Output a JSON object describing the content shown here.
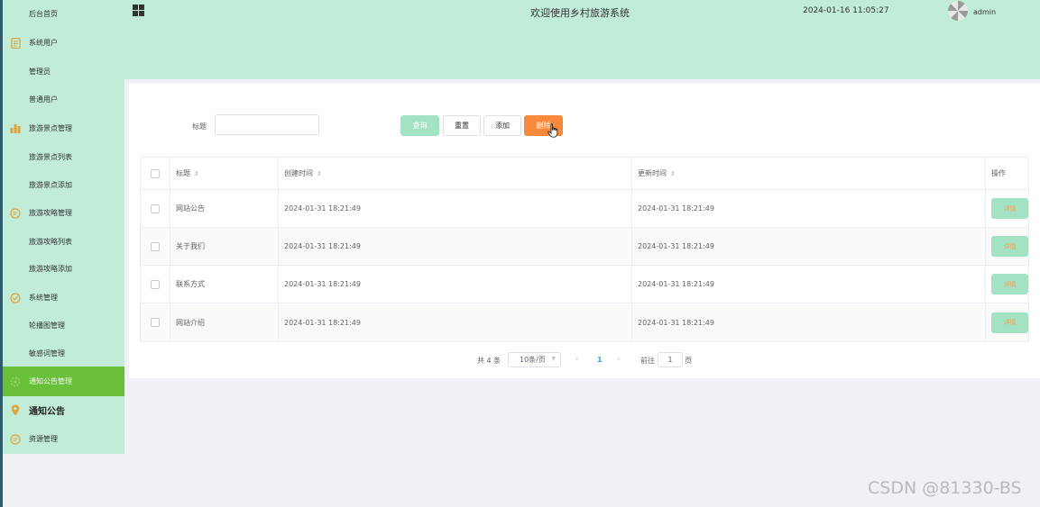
{
  "colors": {
    "sidebar_bg": "#c0ecd8",
    "active_bg": "#6ac03b",
    "primary_light": "#a3e3c4",
    "danger": "#f6893b",
    "link": "#35a0e6"
  },
  "sidebar": {
    "items": [
      {
        "label": "后台首页",
        "icon": ""
      },
      {
        "label": "系统用户",
        "icon": "document-icon"
      },
      {
        "label": "管理员",
        "icon": ""
      },
      {
        "label": "普通用户",
        "icon": ""
      },
      {
        "label": "旅游景点管理",
        "icon": "bar-chart-icon"
      },
      {
        "label": "旅游景点列表",
        "icon": ""
      },
      {
        "label": "旅游景点添加",
        "icon": ""
      },
      {
        "label": "旅游攻略管理",
        "icon": "chat-icon"
      },
      {
        "label": "旅游攻略列表",
        "icon": ""
      },
      {
        "label": "旅游攻略添加",
        "icon": ""
      },
      {
        "label": "系统管理",
        "icon": "check-circle-icon"
      },
      {
        "label": "轮播图管理",
        "icon": ""
      },
      {
        "label": "敏感词管理",
        "icon": ""
      },
      {
        "label": "通知公告管理",
        "icon": "gear-icon"
      },
      {
        "label": "通知公告",
        "icon": "location-icon"
      },
      {
        "label": "资源管理",
        "icon": "chat-icon"
      }
    ]
  },
  "header": {
    "title": "欢迎使用乡村旅游系统",
    "datetime": "2024-01-16 11:05:27",
    "username": "admin"
  },
  "search": {
    "label": "标题",
    "value": "",
    "placeholder": ""
  },
  "toolbar": {
    "query": "查询",
    "reset": "重置",
    "add": "添加",
    "delete": "删除"
  },
  "table": {
    "columns": [
      "标题",
      "创建时间",
      "更新时间",
      "操作"
    ],
    "rows": [
      {
        "title": "网站公告",
        "created": "2024-01-31 18:21:49",
        "updated": "2024-01-31 18:21:49",
        "action": "详情"
      },
      {
        "title": "关于我们",
        "created": "2024-01-31 18:21:49",
        "updated": "2024-01-31 18:21:49",
        "action": "详情"
      },
      {
        "title": "联系方式",
        "created": "2024-01-31 18:21:49",
        "updated": "2024-01-31 18:21:49",
        "action": "详情"
      },
      {
        "title": "网站介绍",
        "created": "2024-01-31 18:21:49",
        "updated": "2024-01-31 18:21:49",
        "action": "详情"
      }
    ]
  },
  "pagination": {
    "total": "共 4 条",
    "page_size": "10条/页",
    "current": "1",
    "goto_label": "前往",
    "goto_value": "1",
    "page_suffix": "页"
  },
  "watermark": "CSDN @81330-BS"
}
